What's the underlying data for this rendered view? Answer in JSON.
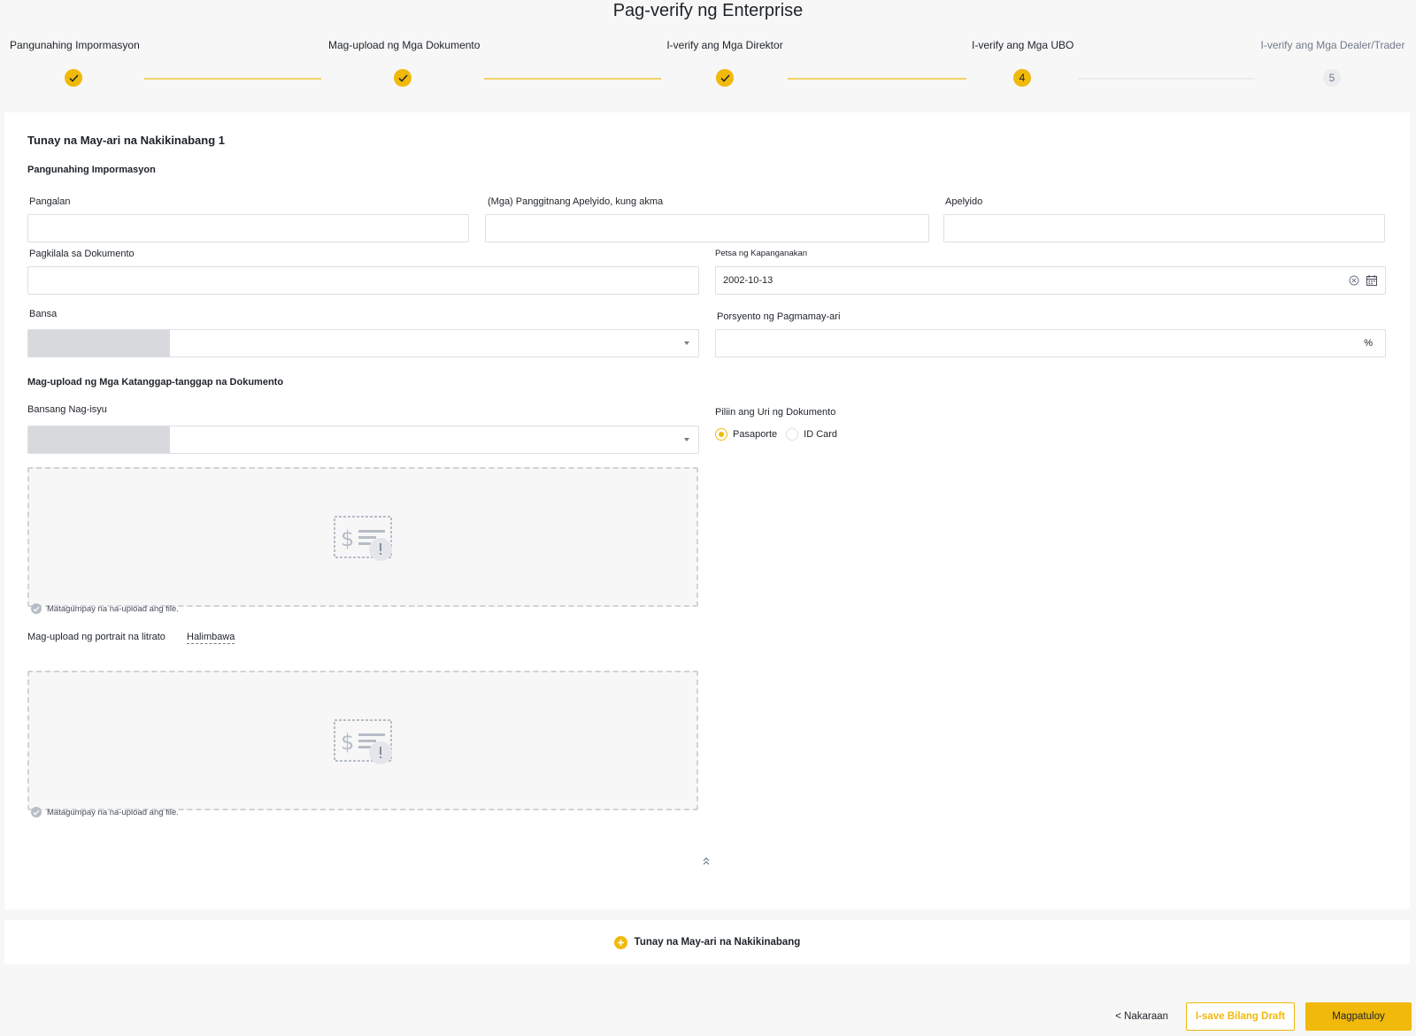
{
  "page": {
    "title": "Pag-verify ng Enterprise"
  },
  "stepper": {
    "steps": [
      {
        "label": "Pangunahing Impormasyon",
        "state": "done"
      },
      {
        "label": "Mag-upload ng Mga Dokumento",
        "state": "done"
      },
      {
        "label": "I-verify ang Mga Direktor",
        "state": "done"
      },
      {
        "label": "I-verify ang Mga UBO",
        "state": "active",
        "number": "4"
      },
      {
        "label": "I-verify ang Mga Dealer/Trader",
        "state": "todo",
        "number": "5"
      }
    ]
  },
  "form": {
    "card_title": "Tunay na May-ari na Nakikinabang 1",
    "basic_info_title": "Pangunahing Impormasyon",
    "first_name": {
      "label": "Pangalan",
      "value": ""
    },
    "middle_name": {
      "label": "(Mga) Panggitnang Apelyido, kung akma",
      "value": ""
    },
    "last_name": {
      "label": "Apelyido",
      "value": ""
    },
    "document_id": {
      "label": "Pagkilala sa Dokumento",
      "value": ""
    },
    "birth_date": {
      "label": "Petsa ng Kapanganakan",
      "value": "2002-10-13"
    },
    "country": {
      "label": "Bansa",
      "value": ""
    },
    "ownership": {
      "label": "Porsyento ng Pagmamay-ari",
      "value": "",
      "suffix": "%"
    },
    "upload_title": "Mag-upload ng Mga Katanggap-tanggap na Dokumento",
    "issuing_country": {
      "label": "Bansang Nag-isyu",
      "value": ""
    },
    "doc_type": {
      "label": "Piliin ang Uri ng Dokumento",
      "options": [
        "Pasaporte",
        "ID Card"
      ],
      "selected": "Pasaporte"
    },
    "upload_status": "Matagumpay na na-upload ang file.",
    "portrait_label": "Mag-upload ng portrait na litrato",
    "example_link": "Halimbawa"
  },
  "add_owner": {
    "label": "Tunay na May-ari na Nakikinabang"
  },
  "footer": {
    "prev": "< Nakaraan",
    "draft": "I-save Bilang Draft",
    "continue": "Magpatuloy"
  },
  "colors": {
    "accent": "#f0b90b",
    "line_done": "#f0d36a",
    "border": "#dcdfe4"
  },
  "icons": [
    "check-icon",
    "calendar-icon",
    "clear-icon",
    "caret-down-icon",
    "document-placeholder-icon",
    "success-icon",
    "chevron-up-double-icon",
    "plus-circle-icon"
  ]
}
